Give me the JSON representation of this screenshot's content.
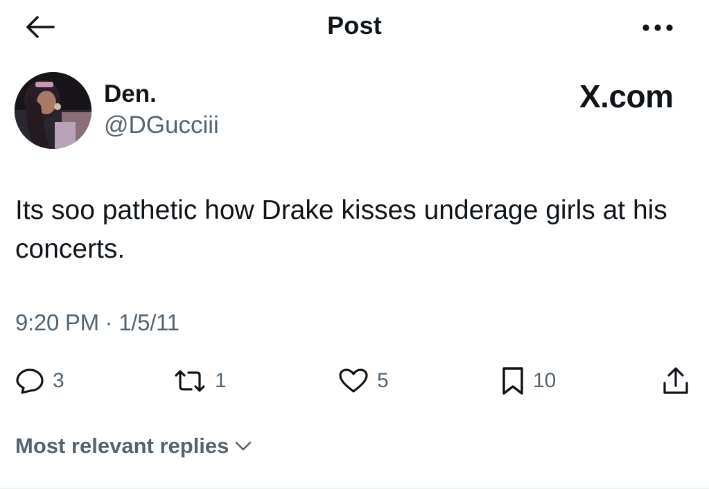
{
  "header": {
    "title": "Post",
    "back_icon": "arrow-left-icon",
    "more_icon": "ellipsis-icon"
  },
  "post": {
    "author": {
      "display_name": "Den.",
      "handle": "@DGucciii"
    },
    "brand_mark": "X.com",
    "text": "Its soo pathetic how Drake kisses underage girls at his concerts.",
    "timestamp": "9:20 PM · 1/5/11",
    "actions": {
      "replies": "3",
      "reposts": "1",
      "likes": "5",
      "bookmarks": "10"
    }
  },
  "replies": {
    "sort_label": "Most relevant replies"
  },
  "colors": {
    "text": "#0f1419",
    "secondary": "#536471",
    "background": "#ffffff"
  }
}
